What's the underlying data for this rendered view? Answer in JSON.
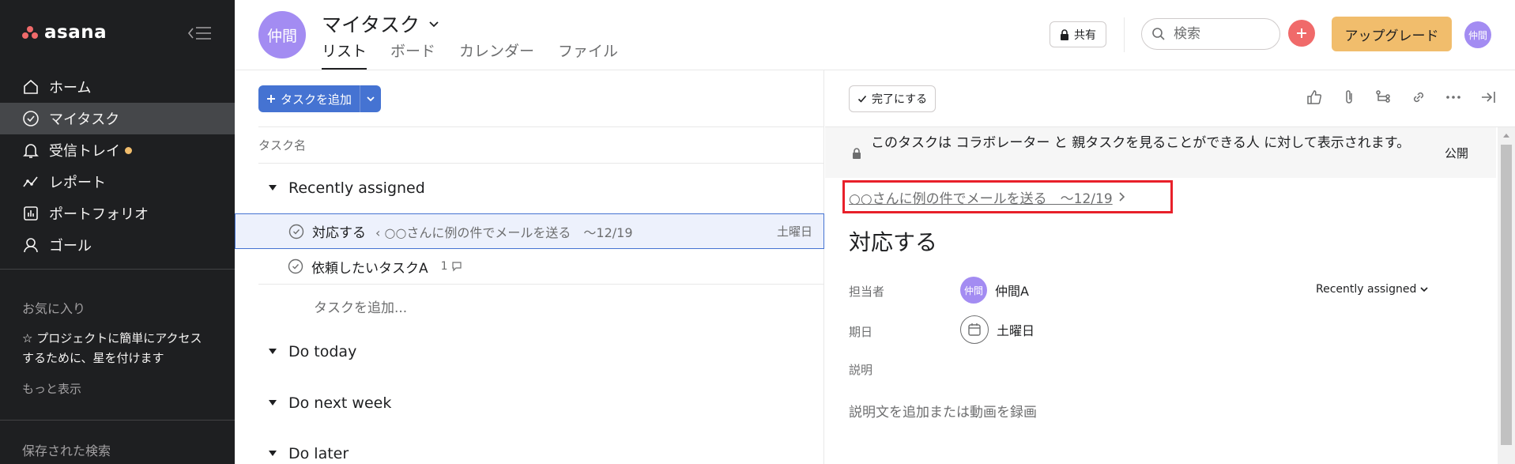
{
  "sidebar": {
    "logo": "asana",
    "nav": [
      {
        "label": "ホーム",
        "icon": "home-icon"
      },
      {
        "label": "マイタスク",
        "icon": "check-circle-icon",
        "active": true
      },
      {
        "label": "受信トレイ",
        "icon": "bell-icon",
        "unread": true
      },
      {
        "label": "レポート",
        "icon": "reports-icon"
      },
      {
        "label": "ポートフォリオ",
        "icon": "portfolio-icon"
      },
      {
        "label": "ゴール",
        "icon": "goal-icon"
      }
    ],
    "favorites_title": "お気に入り",
    "favorites_hint": "☆ プロジェクトに簡単にアクセスするために、星を付けます",
    "more": "もっと表示",
    "saved_searches": "保存された検索"
  },
  "header": {
    "avatar_text": "仲間",
    "title": "マイタスク",
    "tabs": [
      "リスト",
      "ボード",
      "カレンダー",
      "ファイル"
    ],
    "share": "共有",
    "search_placeholder": "検索",
    "upgrade": "アップグレード",
    "user_avatar": "仲間"
  },
  "list": {
    "add_task": "タスクを追加",
    "column_task_name": "タスク名",
    "sections": [
      "Recently assigned",
      "Do today",
      "Do next week",
      "Do later"
    ],
    "tasks": [
      {
        "name": "対応する",
        "parent": "○○さんに例の件でメールを送る　～12/19",
        "date": "土曜日"
      },
      {
        "name": "依頼したいタスクA",
        "comments": "1"
      }
    ],
    "add_inline": "タスクを追加..."
  },
  "detail": {
    "complete": "完了にする",
    "privacy_text": "このタスクは コラボレーター と 親タスクを見ることができる人 に対して表示されます。",
    "privacy_public": "公開",
    "parent_link": "○○さんに例の件でメールを送る　～12/19",
    "title": "対応する",
    "assignee_label": "担当者",
    "assignee_avatar": "仲間",
    "assignee_name": "仲間A",
    "section": "Recently assigned",
    "due_label": "期日",
    "due_value": "土曜日",
    "desc_label": "説明",
    "desc_placeholder": "説明文を追加または動画を録画"
  },
  "colors": {
    "sidebar_bg": "#1e1f21",
    "accent_blue": "#4573d2",
    "coral": "#f06a6a",
    "upgrade": "#f1bd6c",
    "avatar": "#a38cf2",
    "highlight_red": "#e8202a"
  }
}
